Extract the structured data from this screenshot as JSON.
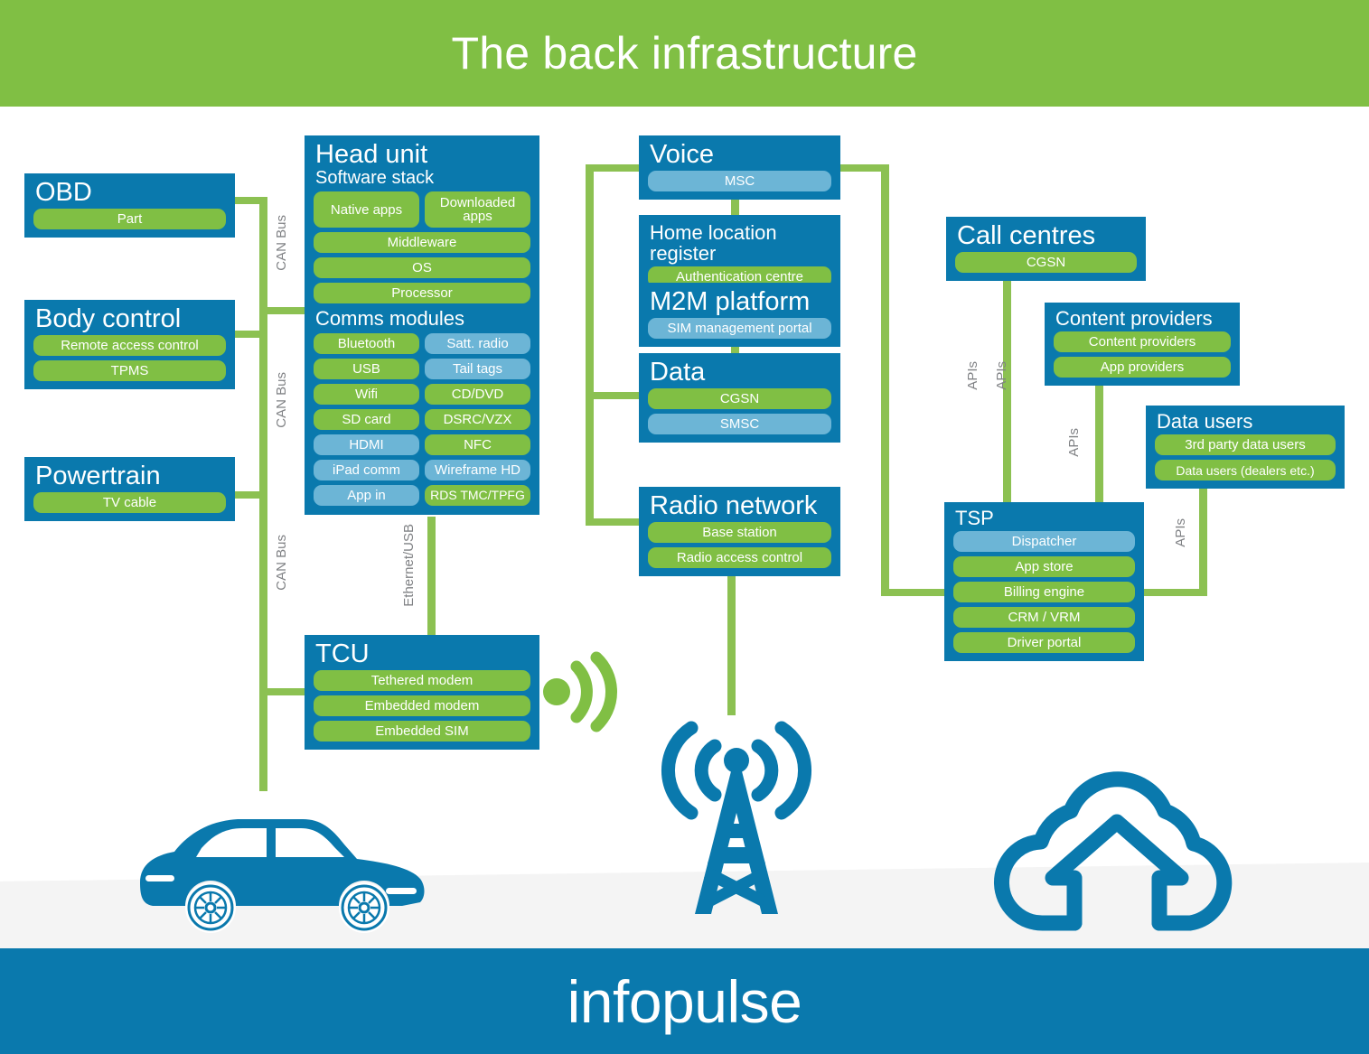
{
  "header": {
    "title": "The back infrastructure"
  },
  "footer": {
    "logo": "infopulse"
  },
  "colors": {
    "brand_blue": "#0a79ad",
    "brand_green": "#80bf44",
    "line_green": "#8cc152",
    "pill_light_blue": "#6cb5d6",
    "label_gray": "#808285"
  },
  "connector_labels": {
    "can_bus_1": "CAN Bus",
    "can_bus_2": "CAN Bus",
    "can_bus_3": "CAN Bus",
    "ethernet_usb": "Ethernet/USB",
    "apis_1": "APIs",
    "apis_2": "APIs",
    "apis_3": "APIs",
    "apis_4": "APIs"
  },
  "cards": {
    "obd": {
      "title": "OBD",
      "items": [
        {
          "label": "Part",
          "tone": "green"
        }
      ]
    },
    "body_control": {
      "title": "Body control",
      "items": [
        {
          "label": "Remote access control",
          "tone": "green"
        },
        {
          "label": "TPMS",
          "tone": "green"
        }
      ]
    },
    "powertrain": {
      "title": "Powertrain",
      "items": [
        {
          "label": "TV cable",
          "tone": "green"
        }
      ]
    },
    "head_unit": {
      "title": "Head unit",
      "subtitle": "Software stack",
      "section2": "Comms modules",
      "stack_row": [
        {
          "label": "Native apps",
          "tone": "green"
        },
        {
          "label": "Downloaded apps",
          "tone": "green"
        }
      ],
      "stack_items": [
        {
          "label": "Middleware",
          "tone": "green"
        },
        {
          "label": "OS",
          "tone": "green"
        },
        {
          "label": "Processor",
          "tone": "green"
        }
      ],
      "comms_left": [
        {
          "label": "Bluetooth",
          "tone": "green"
        },
        {
          "label": "USB",
          "tone": "green"
        },
        {
          "label": "Wifi",
          "tone": "green"
        },
        {
          "label": "SD card",
          "tone": "green"
        },
        {
          "label": "HDMI",
          "tone": "blue"
        },
        {
          "label": "iPad comm",
          "tone": "blue"
        },
        {
          "label": "App in",
          "tone": "blue"
        }
      ],
      "comms_right": [
        {
          "label": "Satt. radio",
          "tone": "blue"
        },
        {
          "label": "Tail tags",
          "tone": "blue"
        },
        {
          "label": "CD/DVD",
          "tone": "green"
        },
        {
          "label": "DSRC/VZX",
          "tone": "green"
        },
        {
          "label": "NFC",
          "tone": "green"
        },
        {
          "label": "Wireframe HD",
          "tone": "blue"
        },
        {
          "label": "RDS TMC/TPFG",
          "tone": "green"
        }
      ]
    },
    "tcu": {
      "title": "TCU",
      "items": [
        {
          "label": "Tethered modem",
          "tone": "green"
        },
        {
          "label": "Embedded modem",
          "tone": "green"
        },
        {
          "label": "Embedded SIM",
          "tone": "green"
        }
      ]
    },
    "voice": {
      "title": "Voice",
      "items": [
        {
          "label": "MSC",
          "tone": "blue"
        }
      ]
    },
    "hlr": {
      "title": "Home location register",
      "items": [
        {
          "label": "Authentication centre",
          "tone": "green"
        }
      ]
    },
    "m2m": {
      "title": "M2M platform",
      "items": [
        {
          "label": "SIM management portal",
          "tone": "blue"
        }
      ]
    },
    "data": {
      "title": "Data",
      "items": [
        {
          "label": "CGSN",
          "tone": "green"
        },
        {
          "label": "SMSC",
          "tone": "blue"
        }
      ]
    },
    "radio_network": {
      "title": "Radio network",
      "items": [
        {
          "label": "Base station",
          "tone": "green"
        },
        {
          "label": "Radio access control",
          "tone": "green"
        }
      ]
    },
    "call_centres": {
      "title": "Call centres",
      "items": [
        {
          "label": "CGSN",
          "tone": "green"
        }
      ]
    },
    "content_providers": {
      "title": "Content providers",
      "items": [
        {
          "label": "Content providers",
          "tone": "green"
        },
        {
          "label": "App providers",
          "tone": "green"
        }
      ]
    },
    "data_users": {
      "title": "Data users",
      "items": [
        {
          "label": "3rd party data users",
          "tone": "green"
        },
        {
          "label": "Data users (dealers etc.)",
          "tone": "green"
        }
      ]
    },
    "tsp": {
      "title": "TSP",
      "items": [
        {
          "label": "Dispatcher",
          "tone": "blue"
        },
        {
          "label": "App store",
          "tone": "green"
        },
        {
          "label": "Billing engine",
          "tone": "green"
        },
        {
          "label": "CRM / VRM",
          "tone": "green"
        },
        {
          "label": "Driver portal",
          "tone": "green"
        }
      ]
    }
  },
  "illustrations": {
    "car": "car-icon",
    "tower": "radio-tower-icon",
    "cloud": "cloud-upload-icon",
    "wifi_burst": "wifi-signal-icon"
  }
}
